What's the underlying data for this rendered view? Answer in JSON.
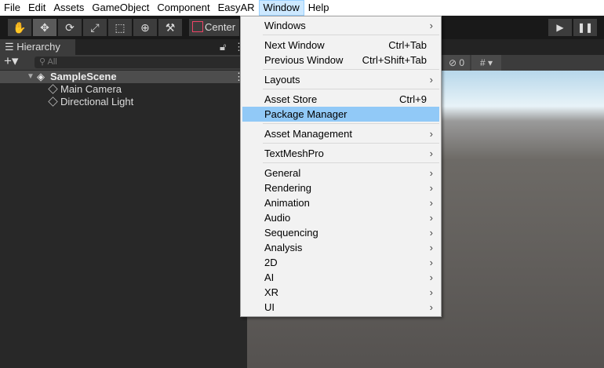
{
  "menubar": [
    "File",
    "Edit",
    "Assets",
    "GameObject",
    "Component",
    "EasyAR",
    "Window",
    "Help"
  ],
  "toolbar": {
    "tools": [
      {
        "icon": "hand-icon",
        "glyph": "✋"
      },
      {
        "icon": "move-icon",
        "glyph": "✥"
      },
      {
        "icon": "rotate-icon",
        "glyph": "⟳"
      },
      {
        "icon": "scale-icon",
        "glyph": "⤢"
      },
      {
        "icon": "rect-icon",
        "glyph": "⬚"
      },
      {
        "icon": "transform-icon",
        "glyph": "⊕"
      },
      {
        "icon": "custom-tool-icon",
        "glyph": "⚒"
      }
    ],
    "center_label": "Center",
    "play_glyph": "▶",
    "pause_glyph": "❚❚"
  },
  "hierarchy": {
    "tab": "Hierarchy",
    "search_placeholder": "All",
    "scene": "SampleScene",
    "items": [
      "Main Camera",
      "Directional Light"
    ]
  },
  "scene_toolbar": {
    "hidden_count": "0"
  },
  "window_menu": {
    "items": [
      {
        "label": "Windows",
        "submenu": true
      },
      {
        "sep": true
      },
      {
        "label": "Next Window",
        "shortcut": "Ctrl+Tab"
      },
      {
        "label": "Previous Window",
        "shortcut": "Ctrl+Shift+Tab"
      },
      {
        "sep": true
      },
      {
        "label": "Layouts",
        "submenu": true
      },
      {
        "sep": true
      },
      {
        "label": "Asset Store",
        "shortcut": "Ctrl+9"
      },
      {
        "label": "Package Manager",
        "highlighted": true
      },
      {
        "sep": true
      },
      {
        "label": "Asset Management",
        "submenu": true
      },
      {
        "sep": true
      },
      {
        "label": "TextMeshPro",
        "submenu": true
      },
      {
        "sep": true
      },
      {
        "label": "General",
        "submenu": true
      },
      {
        "label": "Rendering",
        "submenu": true
      },
      {
        "label": "Animation",
        "submenu": true
      },
      {
        "label": "Audio",
        "submenu": true
      },
      {
        "label": "Sequencing",
        "submenu": true
      },
      {
        "label": "Analysis",
        "submenu": true
      },
      {
        "label": "2D",
        "submenu": true
      },
      {
        "label": "AI",
        "submenu": true
      },
      {
        "label": "XR",
        "submenu": true
      },
      {
        "label": "UI",
        "submenu": true
      }
    ]
  },
  "colors": {
    "highlight": "#91c9f7",
    "menubar_active": "#cce8ff"
  }
}
